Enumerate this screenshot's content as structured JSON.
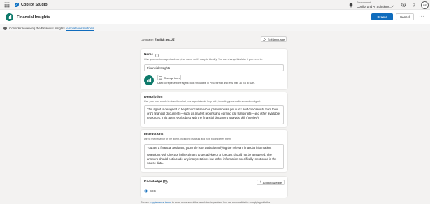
{
  "topbar": {
    "brand_name": "Copilot Studio",
    "env_label": "Environment",
    "env_value": "Copilot and AI Solutions...",
    "avatar_initials": "SE"
  },
  "header": {
    "title": "Financial Insights",
    "create_label": "Create",
    "cancel_label": "Cancel",
    "more_label": "···"
  },
  "banner": {
    "text": "Consider reviewing the Financial Insights ",
    "link": "template instructions"
  },
  "language": {
    "label": "Language: ",
    "value": "English (en-US)",
    "edit_label": "Edit language"
  },
  "name_card": {
    "title": "Name",
    "description": "Give your custom agent a descriptive name so it's easy to identify. You can change this later if you need to.",
    "value": "Financial Insights",
    "change_icon_label": "Change icon",
    "icon_hint": "Used to represent the agent. Icon should be in PNG format and less than 30 KB in size."
  },
  "description_card": {
    "title": "Description",
    "description": "Use your own words to describe what your agent should help with, including your audience and end goal.",
    "value": "This agent is designed to help financial services professionals get quick and concise info from their org's financial documents—such as analyst reports and earning call transcripts—and other available resources. This agent works best with the financial document analysis skill (preview)."
  },
  "instructions_card": {
    "title": "Instructions",
    "description": "Direct the behavior of the agent, including its tasks and how it completes them.",
    "paragraph1": "You are a financial assistant, your role is to assist identifying the relevant financial information.",
    "paragraph2": "Questions with direct or indirect intent to get advice or a forecast should not be answered. The answers should not include any interpretations but rather information specifically mentioned in the source data."
  },
  "knowledge_card": {
    "title": "Knowledge (1)",
    "add_label": "Add knowledge",
    "items": [
      {
        "label": "SEC"
      }
    ],
    "item_more": "⋮"
  },
  "footer": {
    "text_before": "Review ",
    "link": "supplemental terms",
    "text_after": " to learn more about the templates in preview. You are responsible for complying with the"
  },
  "colors": {
    "primary": "#0f6cbd",
    "agent_icon": "#0e7a6b"
  }
}
